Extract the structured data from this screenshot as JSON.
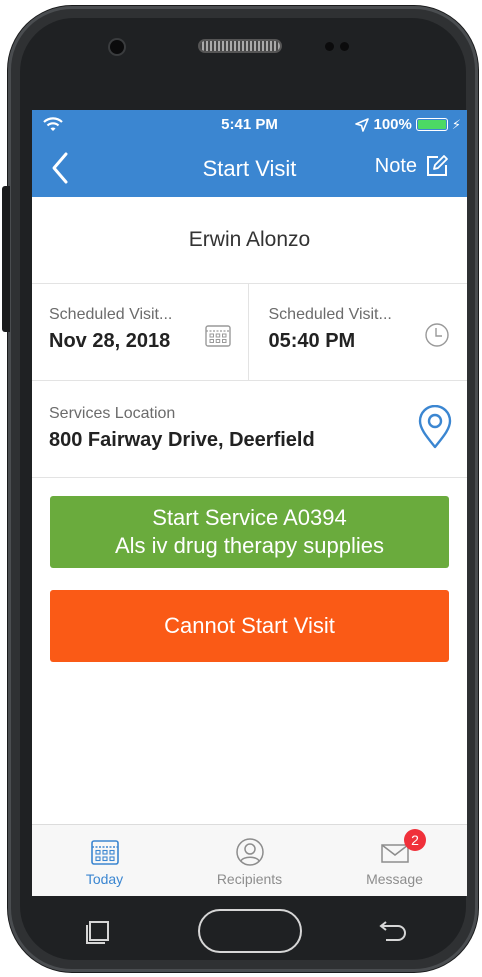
{
  "status_bar": {
    "time": "5:41 PM",
    "battery": "100%",
    "battery_level": 1.0
  },
  "nav": {
    "title": "Start Visit",
    "note_label": "Note"
  },
  "visit": {
    "recipient_name": "Erwin Alonzo",
    "scheduled_date": {
      "label": "Scheduled Visit...",
      "value": "Nov 28, 2018"
    },
    "scheduled_time": {
      "label": "Scheduled Visit...",
      "value": "05:40 PM"
    },
    "location": {
      "label": "Services Location",
      "value": "800 Fairway Drive, Deerfield"
    }
  },
  "actions": {
    "start_service_line1": "Start Service A0394",
    "start_service_line2": "Als iv drug therapy supplies",
    "cannot_start": "Cannot Start Visit"
  },
  "tabs": [
    {
      "label": "Today",
      "active": true
    },
    {
      "label": "Recipients",
      "active": false
    },
    {
      "label": "Message",
      "active": false,
      "badge": "2"
    }
  ],
  "colors": {
    "primary": "#3b86d1",
    "green_button": "#6aab3d",
    "orange_button": "#fa5a16",
    "badge": "#f0303a"
  }
}
